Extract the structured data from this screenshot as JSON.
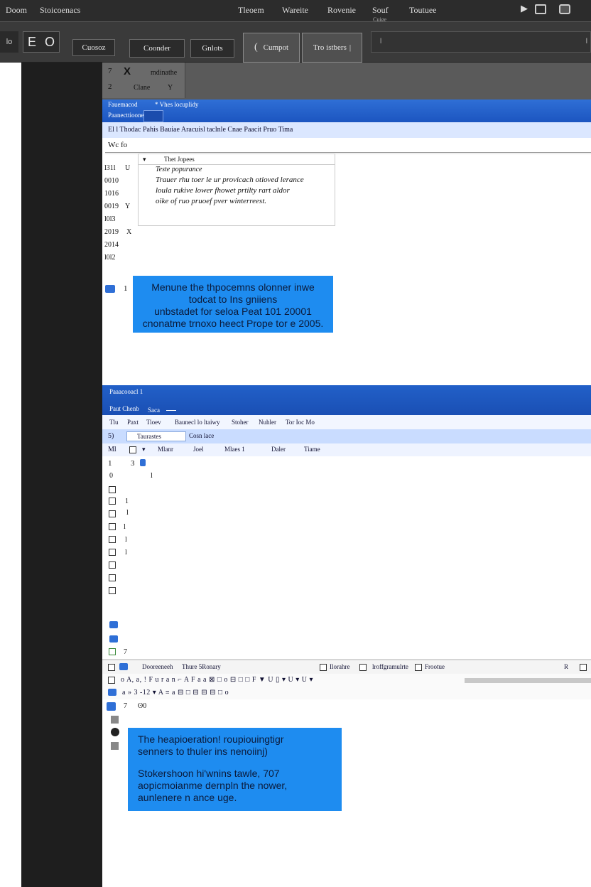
{
  "menubar": {
    "left_items": [
      "Doom",
      "Stoicoenacs"
    ],
    "center_items": [
      "Tleoem",
      "Wareite",
      "Rovenie",
      "Souf",
      "Toutuee"
    ],
    "sub_label": "Cuige"
  },
  "toolbar": {
    "left_text": "lo",
    "e_label": "E",
    "o_label": "O",
    "buttons": [
      "Cuosoz",
      "Coonder",
      "Gnlots",
      "Cumpot",
      "Tro istbers"
    ],
    "cumpot_prefix": "(",
    "tro_suffix": "|",
    "field_text": "l"
  },
  "panel_top": {
    "close_glyph": "X",
    "line1_prefix": "7",
    "line1_text": "mdinathe",
    "line2_prefix": "2",
    "line2_text": "Clane",
    "line2_suffix": "Y"
  },
  "window1": {
    "title": "Fauemacod",
    "title_meta": "* Vhes    locuplidy",
    "subtitle": "Paanecttioone",
    "tab_bar": "El  l Thodac Pahis  Bauiae  Aracuisl taclnle  Cnae Paacit  Pruo Tima",
    "ribbon_line": "Wc  fo",
    "row_numbers": [
      "l31l",
      "0010",
      "1016",
      "0019",
      "l0l3",
      "2019",
      "2014",
      "l0l2"
    ],
    "row_marks": [
      "U",
      "",
      "Y",
      "",
      "X",
      ""
    ],
    "popup_header": "Thet Jopees",
    "popup_title": "Teste popurance",
    "popup_lines": [
      "Trauer rhu toer le ur provicach otioved lerance",
      "loula rukive lower fhowet prtilty rart aldor",
      "oike of ruo pruoef pver winterreest."
    ],
    "bluebox_index": "1",
    "bluebox_lines": [
      "Menune the thpocemns olonner inwe",
      "todcat to Ins gniiens",
      "unbstadet for seloa Peat 101 20001",
      "cnonatme trnoxo heect Prope tor e 2005."
    ]
  },
  "window2": {
    "title": "Paaacooacl 1",
    "subtitle": "Paut Chenb",
    "subtitle_meta": "Saca",
    "menu": [
      "Tlu",
      "Paxt",
      "Tioev",
      "Baunecl lo ltaiwy",
      "Stoher",
      "Nuhler",
      "Tor Ioc Mo"
    ],
    "tab1": "Taurastes",
    "tab2": "Cosn lace",
    "toolbar_items": [
      "Mlanr",
      "Joel",
      "Mlaes 1",
      "Daler",
      "Tiame"
    ],
    "row_prefix": [
      "5)",
      "Ml"
    ],
    "first_row": [
      "1",
      "3"
    ],
    "rows": [
      "0",
      "l",
      "",
      "1",
      "7",
      "l",
      "l",
      "l",
      "l"
    ],
    "bottom_marks": [
      "",
      "",
      "7"
    ]
  },
  "window3": {
    "toolbar1_items": [
      "Dooreeneeh",
      "Thure 5Ronary",
      "Ilorahre",
      "lroffgramulrte",
      "Frootue",
      "R"
    ],
    "toolbar2_text": "o  A, a,  ! F u r  a n  ⌐  A  F  a  a  ⊠  □  o  ⊟  □  □  F  ▼  U  ▯  ▾  U  ▾  U  ▾",
    "toolbar3_text": "a  » 3  -12  ▾  A  ≡  a  ⊟  □  ⊟  ⊟  ⊟  □  o",
    "line_marker": "7",
    "line_value": "ʘ0",
    "bluebox_lines": [
      "The heapioeration! roupiouingtigr",
      "senners to thuler ins nenoiinj)",
      "",
      "Stokershoon hi'wnins tawle, 707",
      "aopicmoianme dernpln the nower,",
      "aunlenere n ance uge."
    ]
  },
  "colors": {
    "menubar": "#2c2c2c",
    "toolbar": "#3a3a3a",
    "ribbon_blue": "#1c55c0",
    "callout_blue": "#1e8cf0",
    "dark_panel": "#1e1e1e"
  },
  "icons": [
    "monitor-icon",
    "window-icon",
    "expand-arrow-icon",
    "close-icon",
    "chevron-down-icon",
    "checkbox-icon",
    "document-icon"
  ]
}
